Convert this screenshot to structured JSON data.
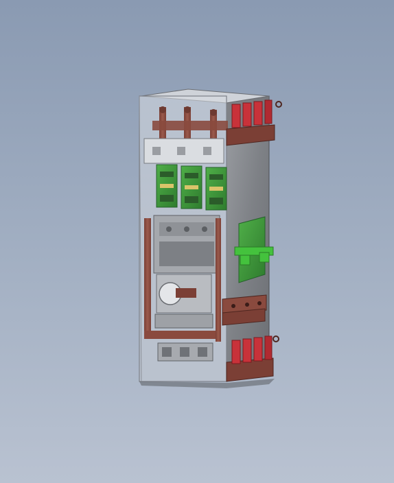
{
  "scene": {
    "subject": "cabinet-3d-model",
    "colors": {
      "background_top": "#8a9ab2",
      "background_bottom": "#b9c2d1",
      "enclosure_glass": "#c9ced6",
      "steel_panel": "#8c8f94",
      "copper_busbar": "#8a4a3e",
      "pcb_green": "#3f9a3c",
      "terminal_red": "#c8323a",
      "connector_green": "#44c23d"
    },
    "parts": {
      "pcb_board_count": 3,
      "top_terminal_count": 4,
      "bottom_terminal_count": 4
    }
  }
}
